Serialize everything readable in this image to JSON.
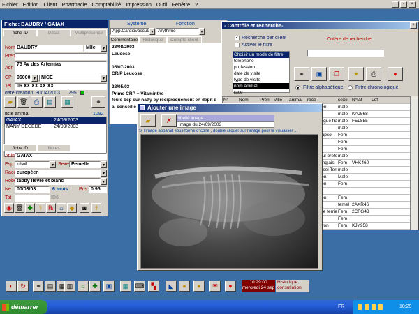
{
  "menu": [
    "Fichier",
    "Edition",
    "Client",
    "Pharmacie",
    "Comptabilité",
    "Impression",
    "Outil",
    "Fenêtre",
    "?"
  ],
  "fiche": {
    "title": "Fiche: BAUDRY / GAIAX",
    "tabs": [
      "fiche ID",
      "Détail",
      "Multiprésence"
    ],
    "nom_label": "Nom",
    "nom": "BAUDRY",
    "civ": "Mlle",
    "pren_label": "Pren",
    "pren": "",
    "adr_label": "Adr",
    "adr": "75 Av des Artemias",
    "cp_label": "CP",
    "cp": "06000",
    "ville": "NICE",
    "tel_label": "Tel",
    "tel": "06 XX XX XX XX",
    "date_creation_label": "date création",
    "date_creation": "30/04/2003",
    "num": "795",
    "liste_label": "liste animal",
    "liste_count": "1092",
    "animals": [
      {
        "name": "GAIAX",
        "date": "24/09/2003"
      },
      {
        "name": "NANY DÉCÉDÉ",
        "date": "24/09/2003"
      }
    ],
    "tabs2": [
      "fiche ID",
      "Notes"
    ],
    "anim_label": "Anim",
    "anim": "GAIAX",
    "esp_label": "Esp",
    "esp": "chat",
    "sexe_label": "Sexe",
    "sexe": "Femelle",
    "race_label": "Race",
    "race": "européen",
    "robe_label": "Robe",
    "robe": "tabby lièvre et blanc",
    "ne_label": "Né",
    "ne": "00/03/03",
    "age": "6 mois",
    "pds_label": "Pds",
    "pds": "0.95",
    "tat_label": "Tat",
    "tat": "",
    "id_label": "ID6"
  },
  "notes": {
    "col1": "Systeme",
    "col2": "Fonction",
    "sys": "App.Cardiovascula",
    "fonc": "Arythmie",
    "tabs": [
      "Commentaire",
      "Historique",
      "Compte client"
    ],
    "lines": [
      "23/08/2003",
      "Leucose",
      "",
      "05/07/2003",
      "CR/P Leucose",
      "",
      "28/05/03",
      "Primo CRP + Vitaminthe",
      "feule bcp sur natty ey reciproquement en depit d",
      "ai conseille feliFriend"
    ]
  },
  "controle": {
    "title": "- Contrôle et recherche-",
    "check1": "Recherche par client",
    "check2": "Activer le filtre",
    "critere": "Critère de recherche",
    "list_header": "Choisir un mode de filtre",
    "list": [
      "telephone",
      "profession",
      "date de visite",
      "type de visite",
      "nom animal",
      "race"
    ],
    "selected_index": 4,
    "radio1": "Filtre alphabétique",
    "radio2": "Filtre chronologique",
    "cols": [
      "N°",
      "Nom",
      "Prén",
      "Ville",
      "animal",
      "race",
      "sexe",
      "N°tat",
      "Lof"
    ],
    "rows": [
      [
        "DU",
        "européen",
        "male",
        "",
        ""
      ],
      [
        "Décédé",
        "caniche",
        "male",
        "KAJ568",
        ""
      ],
      [
        "",
        "bouledogue fran",
        "male",
        "FEL855",
        ""
      ],
      [
        "W",
        "croisé",
        "male",
        "",
        ""
      ],
      [
        "NG",
        "lhassa apso",
        "Fem",
        "",
        ""
      ],
      [
        "KA",
        "caniche",
        "Fem",
        "",
        ""
      ],
      [
        "",
        "beagle",
        "Fem",
        "",
        ""
      ],
      [
        "D",
        "epagneul breton",
        "male",
        "",
        ""
      ],
      [
        "DIKA",
        "setter anglais",
        "Fem",
        "VHK460",
        ""
      ],
      [
        "",
        "jack russel Terrie",
        "male",
        "",
        ""
      ],
      [
        "MEL",
        "européen",
        "Male",
        "",
        ""
      ],
      [
        "DÉCÉ",
        "européen",
        "Fem",
        "",
        ""
      ],
      [
        "",
        "",
        "",
        "",
        ""
      ],
      [
        "K",
        "européen",
        "Fem",
        "",
        ""
      ],
      [
        "LETT",
        "sharpei",
        "femel",
        "2AXR46",
        ""
      ],
      [
        "EN",
        "yorkshire terrier",
        "Fem",
        "2CFG43",
        ""
      ],
      [
        "ENNE",
        "croisé",
        "Fem",
        "",
        ""
      ],
      [
        "IKA",
        "beauceron",
        "Fem",
        "KJY958",
        ""
      ],
      [
        "J",
        "croisé labrador",
        "male",
        "",
        ""
      ],
      [
        "AMIN",
        "européen",
        "Fem",
        "",
        ""
      ]
    ]
  },
  "image_win": {
    "title": "Ajouter une image",
    "libelle": "libellé image",
    "image_date": "image du 24/09/2003",
    "hint": "Si l'image apparait sous forme d'icône , double cliquer sur l'image pour la visualiser ..."
  },
  "bottom": {
    "time": "10:29:00",
    "date": "mercredi 24 sep",
    "hist1": "Historique",
    "hist2": "consultation"
  },
  "taskbar": {
    "start": "démarrer",
    "lang": "FR",
    "clock": "10:29"
  },
  "colors": {
    "desktop": "#3a6ea5",
    "title": "#0a246a",
    "select": "#0a246a",
    "label": "#a00000"
  }
}
